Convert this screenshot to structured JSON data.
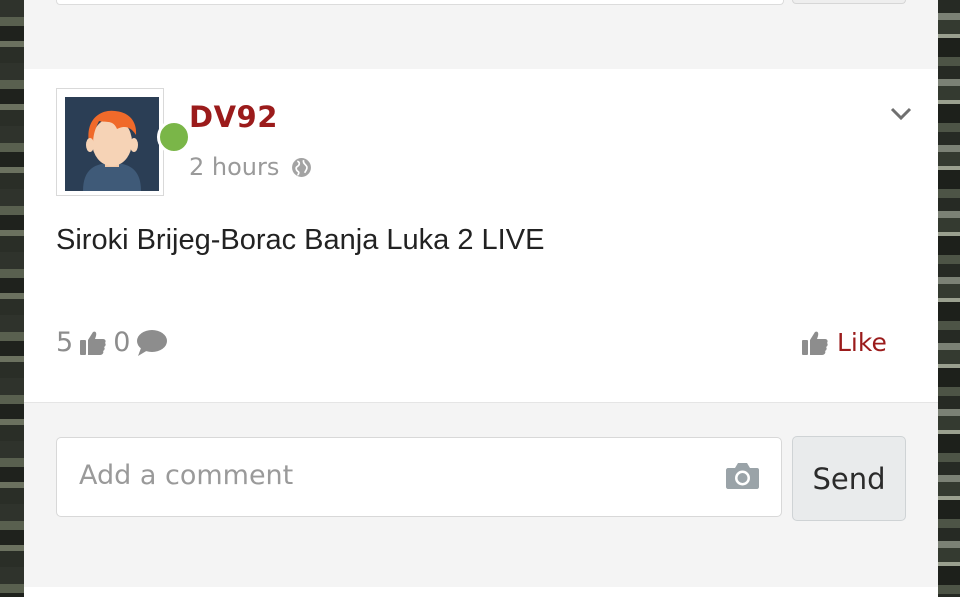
{
  "post": {
    "username": "DV92",
    "time": "2 hours",
    "visibility_icon": "globe-icon",
    "text": "Siroki Brijeg-Borac Banja Luka 2 LIVE",
    "likes_count": "5",
    "comments_count": "0",
    "like_label": "Like",
    "online_status_color": "#7ab648"
  },
  "comment": {
    "placeholder": "Add a comment",
    "send_label": "Send"
  },
  "colors": {
    "accent": "#9b1b1b",
    "muted": "#8d8d8d",
    "background": "#f4f4f4"
  }
}
